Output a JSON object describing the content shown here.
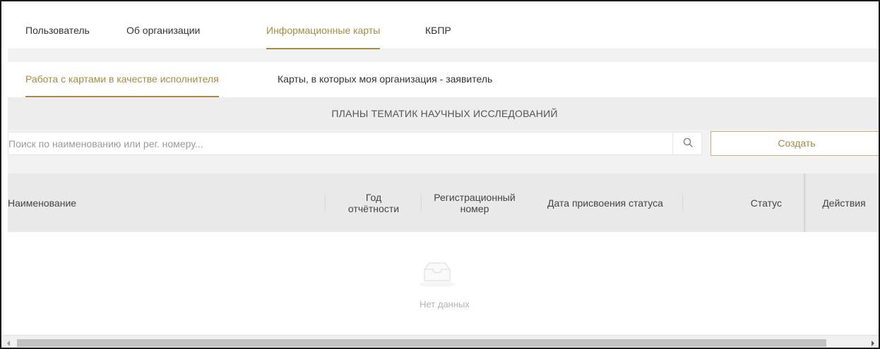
{
  "top_tabs": [
    {
      "label": "Пользователь",
      "active": false
    },
    {
      "label": "Об организации",
      "active": false
    },
    {
      "label": "Информационные карты",
      "active": true
    },
    {
      "label": "КБПР",
      "active": false
    }
  ],
  "sub_tabs": [
    {
      "label": "Работа с картами в качестве исполнителя",
      "active": true
    },
    {
      "label": "Карты, в которых моя организация - заявитель",
      "active": false
    }
  ],
  "section_title": "ПЛАНЫ ТЕМАТИК НАУЧНЫХ ИССЛЕДОВАНИЙ",
  "search": {
    "placeholder": "Поиск по наименованию или рег. номеру...",
    "value": "",
    "icon": "search-icon"
  },
  "create_button_label": "Создать",
  "table": {
    "columns": [
      {
        "label": "Наименование"
      },
      {
        "label_line1": "Год",
        "label_line2": "отчётности"
      },
      {
        "label_line1": "Регистрационный",
        "label_line2": "номер"
      },
      {
        "label": "Дата присвоения статуса"
      },
      {
        "label": "Статус"
      },
      {
        "label": "Действия"
      }
    ],
    "rows": [],
    "empty_text": "Нет данных",
    "empty_icon": "inbox-icon"
  },
  "colors": {
    "accent": "#a88a3f",
    "header_bg": "#e9e9e9",
    "section_bg": "#ededed"
  }
}
